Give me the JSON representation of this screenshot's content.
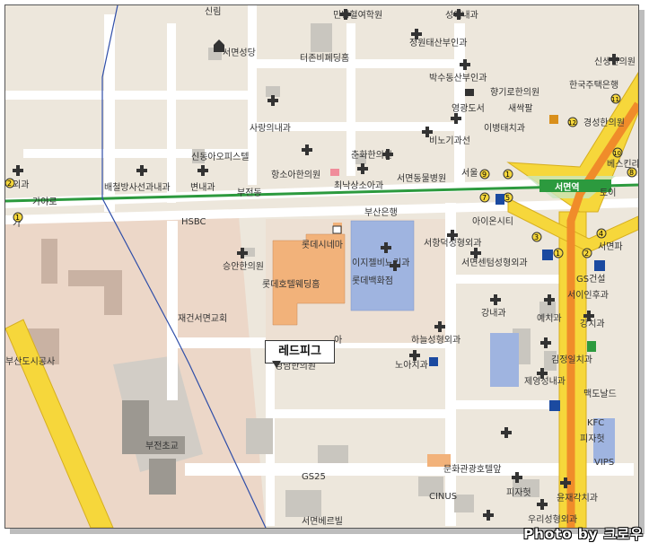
{
  "map": {
    "callout_label": "레드피그",
    "photo_credit": "Photo by 크로우",
    "station_label": "서면역",
    "colors": {
      "background": "#ede7dc",
      "road": "#ffffff",
      "major_road": "#f6d73b",
      "subway_line1": "#f08c2a",
      "subway_line2": "#2c9a3e",
      "building_gray": "#c9c6bf",
      "hotel": "#f2b27a",
      "department_store": "#9fb4e0",
      "park": "#e9d6c6",
      "district_border": "#2f4ea8"
    },
    "labels": {
      "silim": "신림",
      "minbyeong": "민병혈여학원",
      "seongae": "성애내과",
      "jeongwon": "정원태산부인과",
      "seomyeon_church": "서면성당",
      "terjon": "터존비페딩홈",
      "baksu": "박수동산부인과",
      "hyanggiro": "향기로한의원",
      "yeongwang": "영광도서",
      "saejjakbal": "새싹팔",
      "sarang": "사랑의내과",
      "ieungtae": "이병태치과",
      "binogwa": "비노기과선",
      "sindong": "신동아오피스텔",
      "chunhwa": "춘화한의원",
      "seoul": "서울",
      "hangso": "항소아한의원",
      "choinaksang": "최낙상소아과",
      "seomyeon_animal": "서면동물병원",
      "baecheol": "배철방사선과내과",
      "byeonnae": "변내과",
      "bujeondong": "부전동",
      "gayaro": "가야로",
      "oegwa": "외과",
      "hsbc": "HSBC",
      "busan_bank": "부산은행",
      "lotte_cinema": "롯데시네마",
      "lotte_hotel_wedding": "롯데호텔웨딩홈",
      "egel_binogwa": "이지젤비뇨기과",
      "lotte_dept": "롯데백화점",
      "seungan": "승안한의원",
      "aionsiti": "아이온시티",
      "seohyangdeok": "서항덕성형외과",
      "seomyeon_center": "서면센텀성형외과",
      "gs_const": "GS건설",
      "seoiin": "서이인후과",
      "gangnae": "강내과",
      "yechigwa": "예치과",
      "gangchigwa": "강치과",
      "jaegeon_church": "재건서면교회",
      "hanul": "하늘성형외과",
      "noa": "노아치과",
      "kimjeongil": "김정일치과",
      "jeyeong": "제영성내과",
      "mcdonald": "맥도날드",
      "kfc": "KFC",
      "pizzahut": "피자헛",
      "vips": "VIPS",
      "yeongnam": "영남한의원",
      "busan_city": "부산도시공사",
      "bujeon_school": "부전초교",
      "gs25": "GS25",
      "munhwa_hotel": "문화관광호텔앞",
      "cinus": "CINUS",
      "pizzahut2": "피자헛",
      "yujae": "윤재각치과",
      "seomyeon_vill": "서면베르빌",
      "uri": "우리성형외과",
      "singa": "신생한의원",
      "hanguk": "한국주택은행",
      "gyeongseong": "경성한의원",
      "besu": "베스킨라",
      "doi": "토이",
      "seomyeon_pa": "서면파",
      "kg": "가",
      "a_label": "아"
    },
    "line_numbers": [
      "1",
      "2",
      "3",
      "4",
      "5",
      "6",
      "7",
      "8",
      "9",
      "10",
      "11",
      "12"
    ]
  }
}
